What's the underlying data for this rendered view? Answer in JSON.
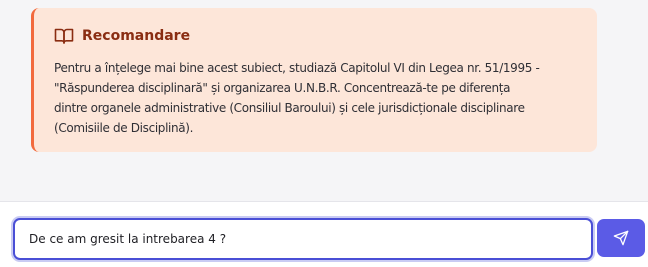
{
  "recommendation": {
    "icon": "book-open-icon",
    "title": "Recomandare",
    "lines": [
      "Pentru a înțelege mai bine acest subiect, studiază Capitolul VI din Legea nr. 51/1995 -",
      "\"Răspunderea disciplinară\" și organizarea U.N.B.R. Concentrează-te pe diferența",
      "dintre organele administrative (Consiliul Baroului) și cele jurisdicționale disciplinare",
      "(Comisiile de Disciplină)."
    ]
  },
  "composer": {
    "input_value": "De ce am gresit la intrebarea 4 ?",
    "send_icon": "send-icon"
  },
  "colors": {
    "card_background": "#fde6d9",
    "card_accent": "#f26a3d",
    "title_color": "#8a2d12",
    "button_color": "#5b5be6",
    "input_border": "#4a4fd6"
  }
}
